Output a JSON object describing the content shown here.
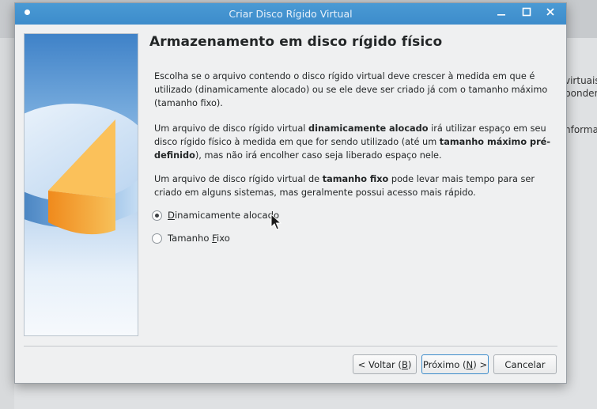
{
  "dialog": {
    "title": "Criar Disco Rígido Virtual",
    "heading": "Armazenamento em disco rígido físico",
    "paragraph1": "Escolha se o arquivo contendo o disco rígido virtual deve crescer à medida em que é utilizado (dinamicamente alocado) ou se ele deve ser criado já com o tamanho máximo (tamanho fixo).",
    "paragraph2": {
      "part1": "Um arquivo de disco rígido virtual ",
      "bold1": "dinamicamente alocado",
      "part2": " irá utilizar espaço em seu disco rígido físico à medida em que for sendo utilizado (até um ",
      "bold2": "tamanho máximo pré-definido",
      "part3": "), mas não irá encolher caso seja liberado espaço nele."
    },
    "paragraph3": {
      "part1": "Um arquivo de disco rígido virtual de ",
      "bold1": "tamanho fixo",
      "part2": " pode levar mais tempo para ser criado em alguns sistemas, mas geralmente possui acesso mais rápido."
    },
    "options": {
      "dynamic": {
        "mnemonic": "D",
        "rest": "inamicamente alocado",
        "selected": true
      },
      "fixed": {
        "prefix": "Tamanho ",
        "mnemonic": "F",
        "rest": "ixo",
        "selected": false
      }
    },
    "buttons": {
      "back": {
        "prefix": "< Voltar (",
        "mnemonic": "B",
        "suffix": ")"
      },
      "next": {
        "prefix": "Próximo (",
        "mnemonic": "N",
        "suffix": ") >"
      },
      "cancel": "Cancelar"
    },
    "titlebar_icons": {
      "minimize": "minimize-icon",
      "maximize": "maximize-icon",
      "close": "close-icon"
    }
  },
  "background": {
    "text1": "virtuais",
    "text2": "pondent",
    "text3": "nforma"
  },
  "colors": {
    "titlebar": "#3d8ccb",
    "accent": "#3d8ccb",
    "dialog_bg": "#eff0f1"
  }
}
